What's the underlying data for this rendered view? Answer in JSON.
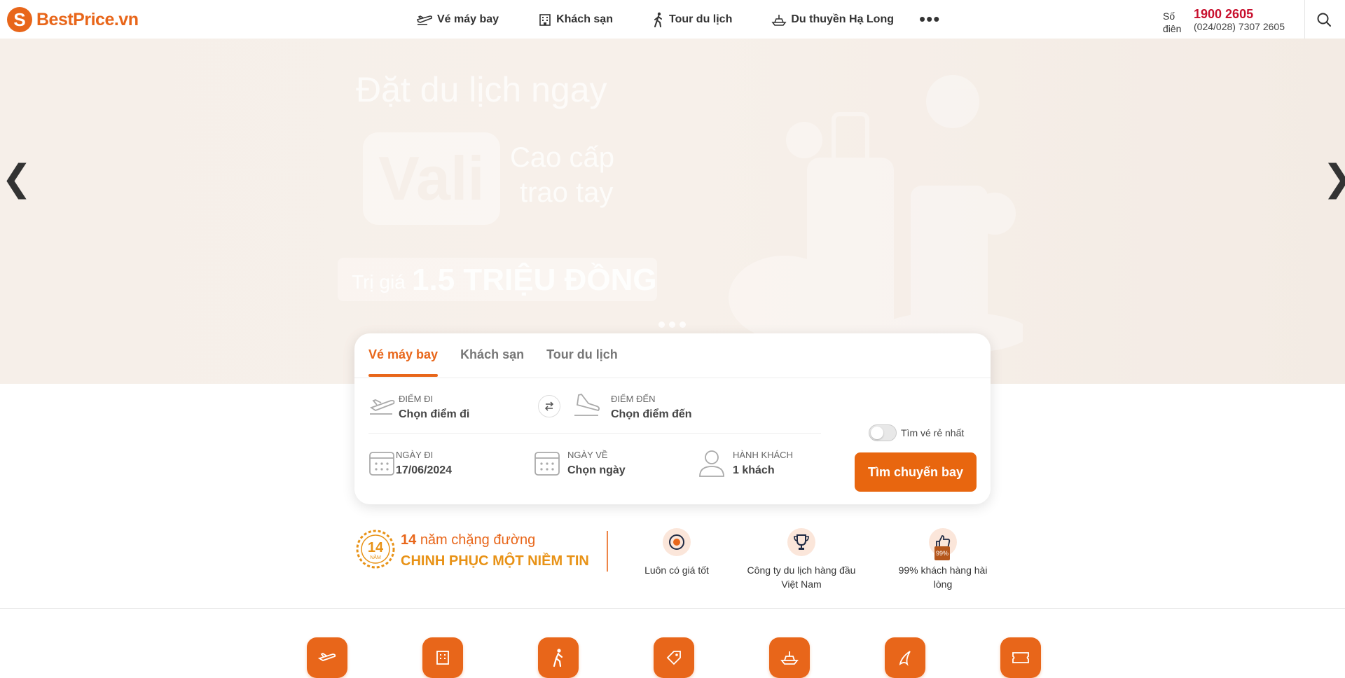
{
  "header": {
    "logo_letter": "S",
    "logo_text": "BestPrice.vn",
    "nav": [
      {
        "label": "Vé máy bay",
        "icon": "plane-icon"
      },
      {
        "label": "Khách sạn",
        "icon": "hotel-icon"
      },
      {
        "label": "Tour du lịch",
        "icon": "walker-icon"
      },
      {
        "label": "Du thuyền Hạ Long",
        "icon": "cruise-icon"
      }
    ],
    "more_label": "•••",
    "phone_label": "Số điện thoại",
    "phone_main": "1900 2605",
    "phone_alt": "(024/028) 7307 2605"
  },
  "banner": {
    "headline": "Đặt du lịch ngay",
    "vali_word": "Vali",
    "vali_sub1": "Cao cấp",
    "vali_sub2": "trao tay",
    "price_prefix": "Trị giá",
    "price_value": "1.5 TRIỆU ĐỒNG",
    "arrow_left": "❮",
    "arrow_right": "❯"
  },
  "search": {
    "tabs": [
      "Vé máy bay",
      "Khách sạn",
      "Tour du lịch"
    ],
    "origin": {
      "label": "ĐIỂM ĐI",
      "value": "Chọn điểm đi"
    },
    "destination": {
      "label": "ĐIỂM ĐẾN",
      "value": "Chọn điểm đến"
    },
    "depart": {
      "label": "NGÀY ĐI",
      "value": "17/06/2024"
    },
    "return": {
      "label": "NGÀY VỀ",
      "value": "Chọn ngày"
    },
    "passengers": {
      "label": "HÀNH KHÁCH",
      "value": "1 khách"
    },
    "cheapest_toggle_label": "Tìm vé rẻ nhất",
    "submit_label": "Tìm chuyến bay"
  },
  "trust": {
    "badge_number": "14",
    "badge_sub": "NĂM",
    "line1_number": "14",
    "line1_text": "năm chặng đường",
    "line2": "CHINH PHỤC MỘT NIỀM TIN",
    "features": [
      {
        "text": "Luôn có giá tốt",
        "icon": "price-tag-icon"
      },
      {
        "text": "Công ty du lịch hàng đầu Việt Nam",
        "icon": "trophy-icon"
      },
      {
        "text": "99% khách hàng hài lòng",
        "icon": "thumbs-up-icon",
        "badge": "99%"
      }
    ]
  },
  "categories": [
    {
      "icon": "flight-category-icon"
    },
    {
      "icon": "hotel-category-icon"
    },
    {
      "icon": "tour-category-icon"
    },
    {
      "icon": "deal-category-icon"
    },
    {
      "icon": "cruise-category-icon"
    },
    {
      "icon": "airline-category-icon"
    },
    {
      "icon": "ticket-category-icon"
    }
  ],
  "colors": {
    "brand": "#e8661a",
    "phone": "#c8102e",
    "gold": "#e89216"
  }
}
